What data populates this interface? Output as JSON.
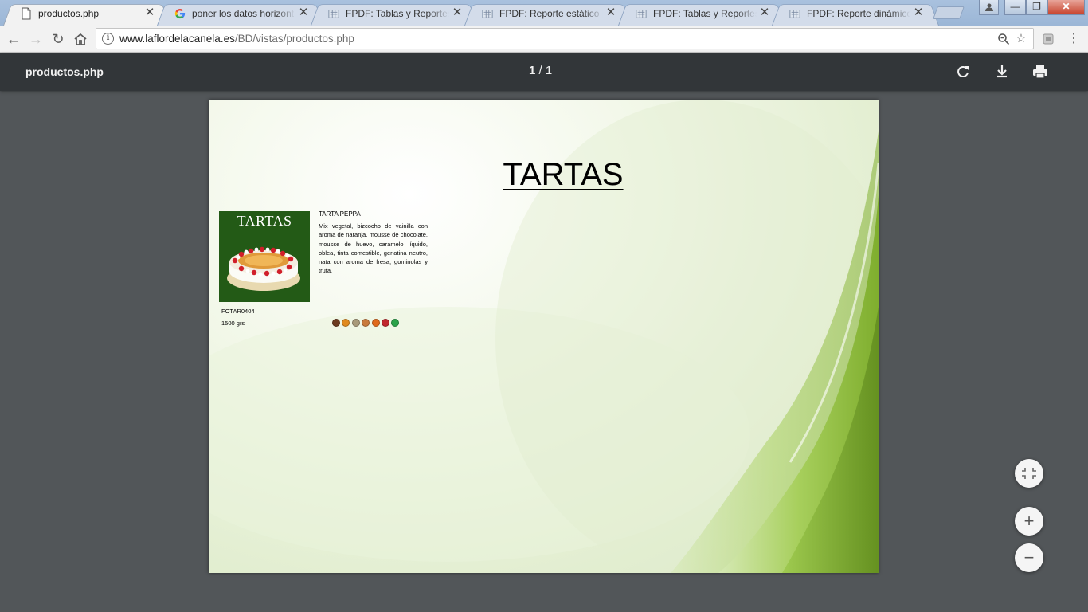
{
  "browser": {
    "tabs": [
      {
        "title": "productos.php",
        "icon": "page-icon",
        "active": true
      },
      {
        "title": "poner los datos horizont",
        "icon": "google-icon",
        "active": false
      },
      {
        "title": "FPDF: Tablas y Reportes",
        "icon": "fpdf-icon",
        "active": false
      },
      {
        "title": "FPDF: Reporte estático |",
        "icon": "fpdf-icon",
        "active": false
      },
      {
        "title": "FPDF: Tablas y Reportes",
        "icon": "fpdf-icon",
        "active": false
      },
      {
        "title": "FPDF: Reporte dinámico",
        "icon": "fpdf-icon",
        "active": false
      }
    ],
    "url_host": "www.laflordelacanela.es",
    "url_path": "/BD/vistas/productos.php"
  },
  "pdf_viewer": {
    "filename": "productos.php",
    "page_current": "1",
    "page_separator": "/",
    "page_total": "1"
  },
  "document": {
    "title": "TARTAS",
    "product": {
      "image_title": "TARTAS",
      "name": "TARTA PEPPA",
      "description": "Mix vegetal, bizcocho de vainilla con aroma de naranja, mousse de chocolate, mousse de huevo, caramelo líquido, oblea, tinta comestible, gerlatina neutro, nata con aroma de fresa, gominolas y trufa.",
      "code": "FOTAR0404",
      "weight": "1500 grs",
      "allergen_colors": [
        "#6b3a1f",
        "#e08a1e",
        "#a89a7a",
        "#c87a3c",
        "#e06a1c",
        "#c0272d",
        "#2aa34a"
      ]
    }
  },
  "colors": {
    "toolbar_bg": "#323639",
    "viewer_bg": "#525659",
    "page_accent": "#8cbf3f"
  }
}
